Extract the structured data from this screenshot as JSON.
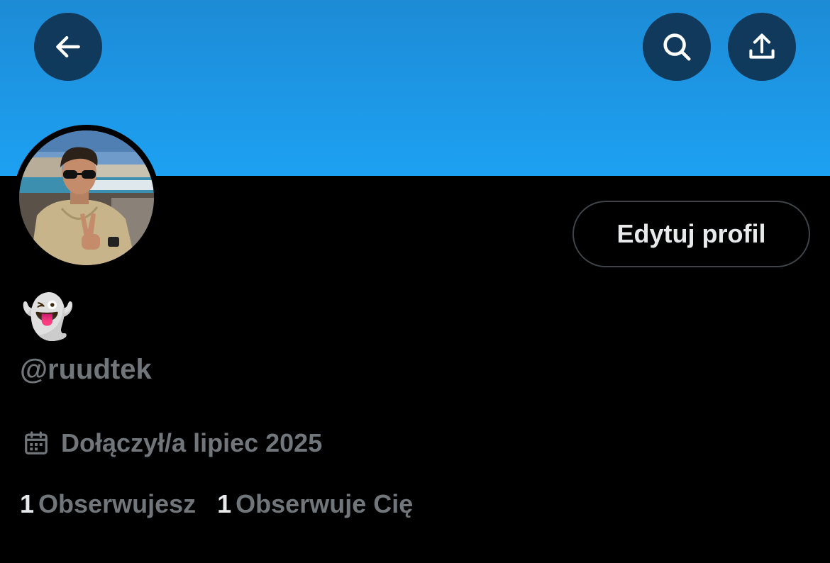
{
  "header": {
    "banner_color": "#1DA1F2",
    "back_icon": "arrow-left-icon",
    "search_icon": "search-icon",
    "share_icon": "share-icon"
  },
  "profile": {
    "display_name": "👻",
    "handle": "@ruudtek",
    "edit_button_label": "Edytuj profil",
    "joined_icon": "calendar-icon",
    "joined_text": "Dołączył/a lipiec 2025",
    "following_count": "1",
    "following_label": "Obserwujesz",
    "followers_count": "1",
    "followers_label": "Obserwuje Cię"
  },
  "colors": {
    "background": "#000000",
    "primary_text": "#E7E9EA",
    "secondary_text": "#71767B",
    "button_border": "#3F4448"
  }
}
